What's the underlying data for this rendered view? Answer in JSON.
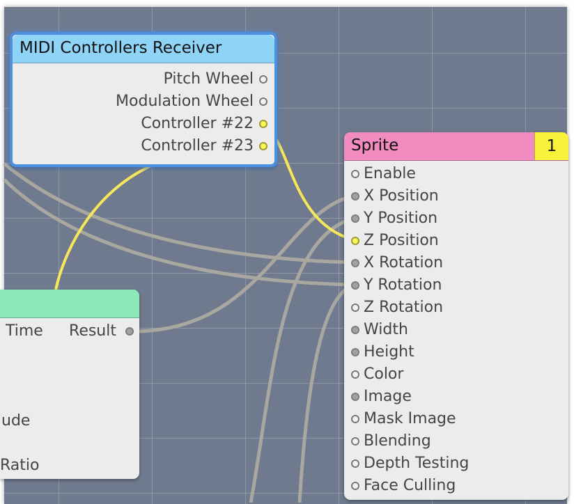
{
  "midi_patch": {
    "title": "MIDI Controllers Receiver",
    "outputs": [
      {
        "label": "Pitch Wheel",
        "port_state": "empty"
      },
      {
        "label": "Modulation Wheel",
        "port_state": "empty"
      },
      {
        "label": "Controller #22",
        "port_state": "connected-yellow"
      },
      {
        "label": "Controller #23",
        "port_state": "connected-yellow"
      }
    ]
  },
  "sprite_patch": {
    "title": "Sprite",
    "badge": "1",
    "inputs": [
      {
        "label": "Enable",
        "port_state": "empty"
      },
      {
        "label": "X Position",
        "port_state": "connected-gray"
      },
      {
        "label": "Y Position",
        "port_state": "connected-gray"
      },
      {
        "label": "Z Position",
        "port_state": "connected-yellow"
      },
      {
        "label": "X Rotation",
        "port_state": "connected-gray"
      },
      {
        "label": "Y Rotation",
        "port_state": "connected-gray"
      },
      {
        "label": "Z Rotation",
        "port_state": "empty"
      },
      {
        "label": "Width",
        "port_state": "connected-gray"
      },
      {
        "label": "Height",
        "port_state": "connected-gray"
      },
      {
        "label": "Color",
        "port_state": "empty"
      },
      {
        "label": "Image",
        "port_state": "connected-gray"
      },
      {
        "label": "Mask Image",
        "port_state": "empty"
      },
      {
        "label": "Blending",
        "port_state": "empty"
      },
      {
        "label": "Depth Testing",
        "port_state": "empty"
      },
      {
        "label": "Face Culling",
        "port_state": "empty"
      }
    ]
  },
  "lfo_patch": {
    "input_time_label": "Time",
    "output_label": "Result",
    "partial_input_1": "ude",
    "partial_input_2": "Ratio"
  },
  "colors": {
    "canvas_bg": "#6f7a8e",
    "wire_gray": "#a9a7a0",
    "wire_yellow": "#f6e65a",
    "midi_header": "#8fd4f6",
    "sprite_header": "#f18bc0",
    "sprite_badge": "#f8f33a",
    "lfo_header": "#8ce9b8",
    "selection_border": "#4a8fe0"
  }
}
